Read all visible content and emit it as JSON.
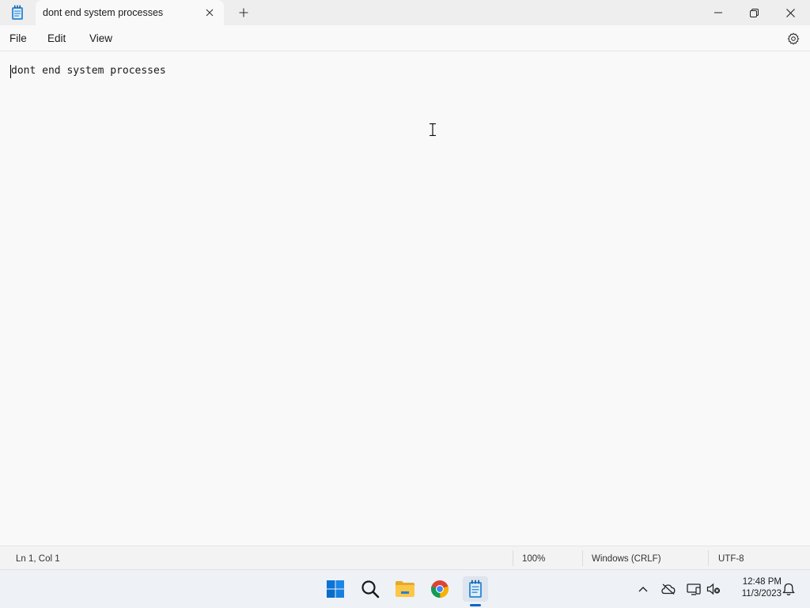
{
  "window": {
    "tab_title": "dont end system processes",
    "new_tab_symbol": "+"
  },
  "menu": {
    "file": "File",
    "edit": "Edit",
    "view": "View"
  },
  "editor": {
    "content": "dont end system processes"
  },
  "status": {
    "position": "Ln 1, Col 1",
    "zoom": "100%",
    "line_ending": "Windows (CRLF)",
    "encoding": "UTF-8"
  },
  "taskbar": {
    "time": "12:48 PM",
    "date": "11/3/2023"
  },
  "icons": [
    "notepad-icon",
    "close-icon",
    "add-tab-icon",
    "minimize-icon",
    "maximize-icon",
    "close-window-icon",
    "gear-icon",
    "windows-start-icon",
    "search-icon",
    "file-explorer-icon",
    "chrome-icon",
    "notepad-icon",
    "chevron-up-icon",
    "cloud-off-icon",
    "display-icon",
    "volume-muted-icon",
    "bell-icon"
  ],
  "colors": {
    "accent": "#0a64c8",
    "editor_bg": "#f9f9f9",
    "titlebar_bg": "#eeeeee",
    "taskbar_bg": "#eef1f6"
  }
}
